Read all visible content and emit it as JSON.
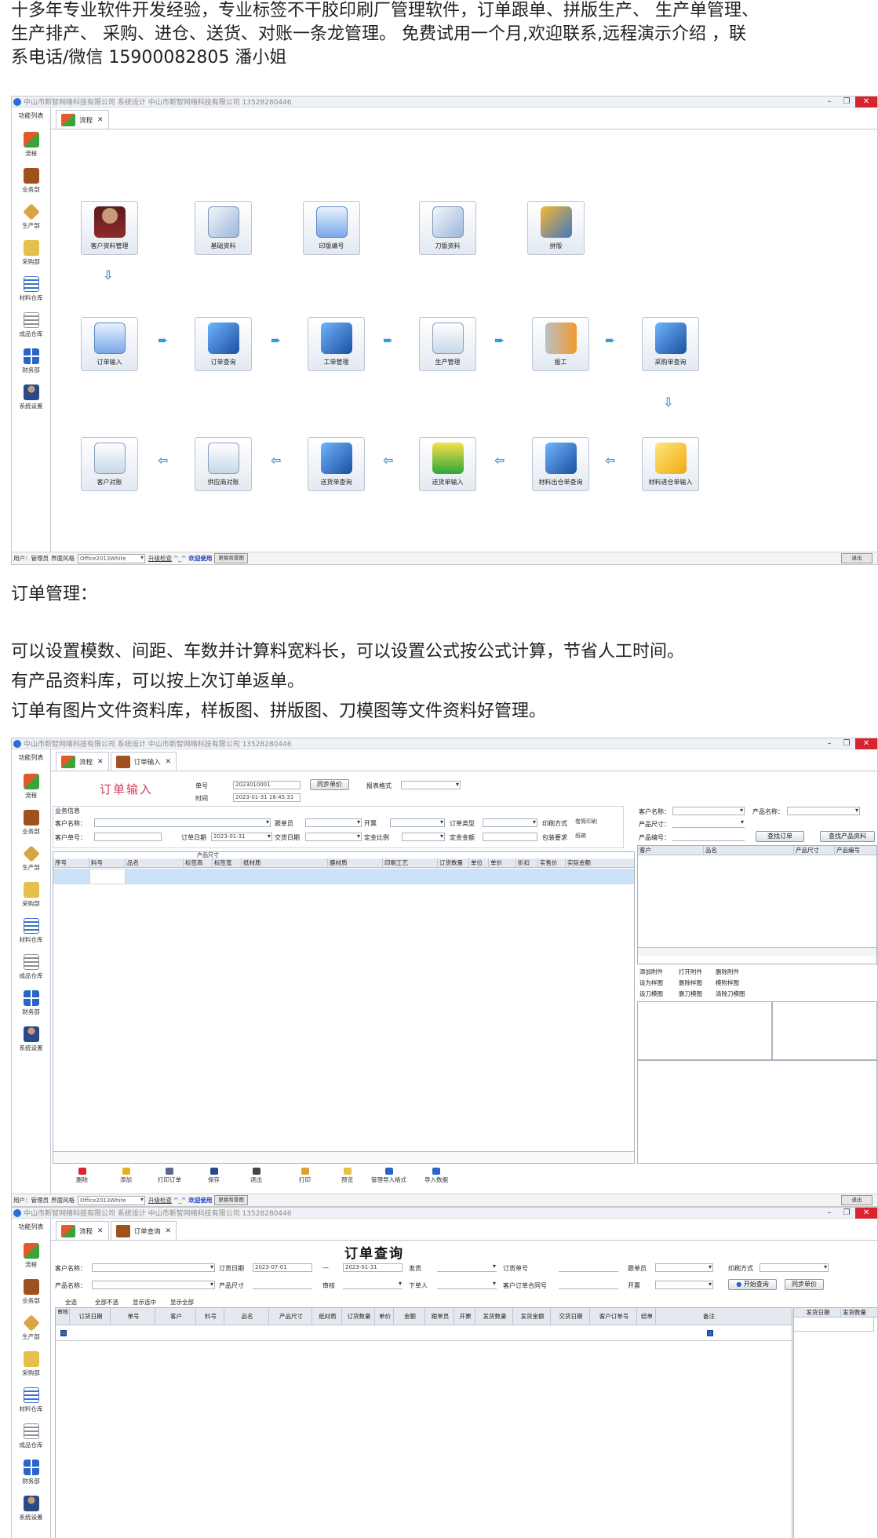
{
  "intro": {
    "line1": "十多年专业软件开发经验，专业标签不干胶印刷厂管理软件，订单跟单、拼版生产、 生产单管理、",
    "line2": "生产排产、 采购、进仓、送货、对账一条龙管理。 免费试用一个月,欢迎联系,远程演示介绍 ，联",
    "line3": "系电话/微信 15900082805 潘小姐"
  },
  "section_title": "订单管理：",
  "features": {
    "line1": "可以设置模数、间距、车数并计算料宽料长，可以设置公式按公式计算，节省人工时间。",
    "line2": "有产品资料库，可以按上次订单返单。",
    "line3": "订单有图片文件资料库，样板图、拼版图、刀模图等文件资料好管理。"
  },
  "window": {
    "title": "中山市新智网络科技有限公司 系统设计 中山市新智网络科技有限公司 13528280446",
    "min": "–",
    "restore": "❐",
    "close": "✕"
  },
  "sidebar": {
    "header": "功能列表",
    "items": [
      {
        "label": "流程",
        "color": "#e0a030"
      },
      {
        "label": "业务部",
        "color": "#a0521e"
      },
      {
        "label": "生产部",
        "color": "#d9a441"
      },
      {
        "label": "采购部",
        "color": "#e5c04a"
      },
      {
        "label": "材料仓库",
        "color": "#3f73c9"
      },
      {
        "label": "成品仓库",
        "color": "#8a8f99"
      },
      {
        "label": "财务部",
        "color": "#2a64c8"
      },
      {
        "label": "系统设置",
        "color": "#7a4a2a"
      }
    ]
  },
  "screen1": {
    "tab": "流程",
    "tab_close": "✕",
    "nodes": {
      "customer": "客户资料管理",
      "basic": "基础资料",
      "print_no": "印版编号",
      "die": "刀版资料",
      "layout": "拼版",
      "order_input": "订单输入",
      "order_query": "订单查询",
      "work_order": "工单管理",
      "production": "生产管理",
      "report_work": "报工",
      "purchase_query": "采购单查询",
      "customer_recon": "客户对账",
      "supplier_recon": "供应商对账",
      "delivery_query": "送货单查询",
      "delivery_input": "送货单输入",
      "material_query": "材料出仓单查询",
      "material_in_input": "材料进仓单输入"
    },
    "arrow_right": "➨",
    "arrow_left": "⇦",
    "arrow_down": "⇩"
  },
  "status": {
    "user": "用户：管理员",
    "skin_label": "界面风格",
    "skin_value": "Office2013White",
    "upgrade": "升级检查",
    "smile": "^_^",
    "welcome": "欢迎使用",
    "change_bg": "更换背景图",
    "exit": "退出"
  },
  "screen2": {
    "tab1": "流程",
    "tab2": "订单输入",
    "tab_close": "✕",
    "title": "订单输入",
    "order_no_label": "单号",
    "order_no": "2023010001",
    "time_label": "时间",
    "time_value": "2023-01-31 16:45:31",
    "sync_btn": "同步单价",
    "report_label": "报表格式",
    "business_label": "业务信息",
    "customer_label": "客户名称：",
    "follower_label": "跟单员",
    "invoice_label": "开票",
    "order_type_label": "订单类型",
    "print_method_label": "印刷方式",
    "print_method_value": "卷筒印刷",
    "customer_no_label": "客户单号：",
    "order_date_label": "订单日期",
    "order_date": "2023-01-31",
    "delivery_date_label": "交货日期",
    "deposit_ratio_label": "定金比例",
    "deposit_amount_label": "定金金额",
    "packing_label": "包装要求",
    "packing_value": "纸箱",
    "size_group": "产品尺寸",
    "columns": [
      "序号",
      "料号",
      "品名",
      "标签高",
      "标签宽",
      "纸材质",
      "膜材质",
      "印刷工艺",
      "订货数量",
      "单位",
      "单价",
      "折扣",
      "实售价",
      "实际金额"
    ],
    "right": {
      "customer_label": "客户名称：",
      "product_label": "产品名称：",
      "size_label": "产品尺寸：",
      "code_label": "产品编号：",
      "find_order": "查找订单",
      "find_product": "查找产品资料",
      "cols": [
        "客户",
        "品名",
        "产品尺寸",
        "产品编号"
      ],
      "links": [
        "添加附件",
        "打开附件",
        "删除附件",
        "设为样图",
        "删除样图",
        "模附样图",
        "设刀模图",
        "删刀模图",
        "清除刀模图"
      ]
    },
    "toolbar": [
      "删除",
      "添加",
      "打印订单",
      "保存",
      "退出",
      "打印",
      "预览",
      "管理导入格式",
      "导入数据"
    ]
  },
  "screen3": {
    "tab1": "流程",
    "tab2": "订单查询",
    "tab_close": "✕",
    "title": "订单查询",
    "customer_label": "客户名称：",
    "order_date_label": "订货日期",
    "date_from": "2023-07-01",
    "dash": "—",
    "date_to": "2023-01-31",
    "delivery_label": "发货",
    "order_no_label": "订货单号",
    "follower_label": "跟单员",
    "print_method_label": "印刷方式",
    "product_label": "产品名称：",
    "size_label": "产品尺寸",
    "audit_label": "审核",
    "placer_label": "下单人",
    "contract_label": "客户订单合同号",
    "invoice_label": "开票",
    "query_btn": "开始查询",
    "sync_btn": "同步单价",
    "select_links": [
      "全选",
      "全部不选",
      "显示选中",
      "显示全部"
    ],
    "columns": [
      "审核",
      "订货日期",
      "单号",
      "客户",
      "料号",
      "品名",
      "产品尺寸",
      "纸材质",
      "订货数量",
      "单价",
      "金额",
      "跟单员",
      "开票",
      "发货数量",
      "发货金额",
      "交货日期",
      "客户订单号",
      "结单",
      "备注"
    ],
    "right_cols": [
      "发货日期",
      "发货数量"
    ]
  }
}
